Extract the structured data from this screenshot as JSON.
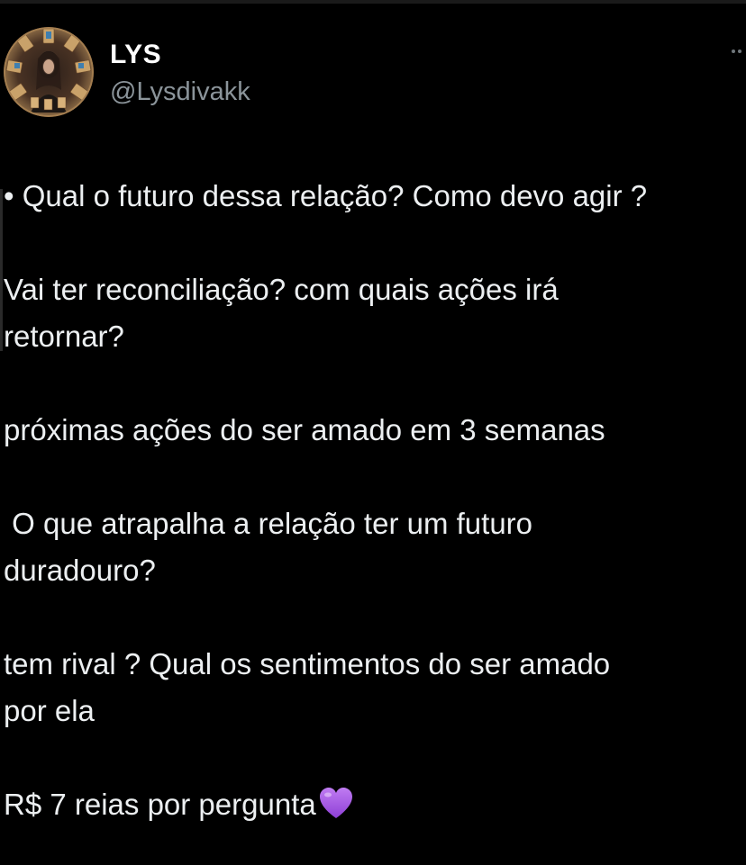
{
  "author": {
    "name": "LYS",
    "handle": "@Lysdivakk"
  },
  "tweet": {
    "paragraphs": [
      "• Qual o futuro dessa relação? Como devo agir ?",
      "Vai ter reconciliação? com quais ações irá\nretornar?",
      "próximas ações do ser amado em 3 semanas",
      " O que atrapalha a relação ter um futuro\nduradouro?",
      "tem rival ? Qual os sentimentos do ser amado\npor ela",
      "R$ 7 reias por pergunta"
    ],
    "emoji": "purple-heart"
  },
  "colors": {
    "background": "#000000",
    "text": "#eceff1",
    "handle": "#8b949a",
    "heart": "#a45ee5"
  },
  "icons": {
    "more": "more-options-icon",
    "avatar": "tarot-reader-avatar"
  }
}
